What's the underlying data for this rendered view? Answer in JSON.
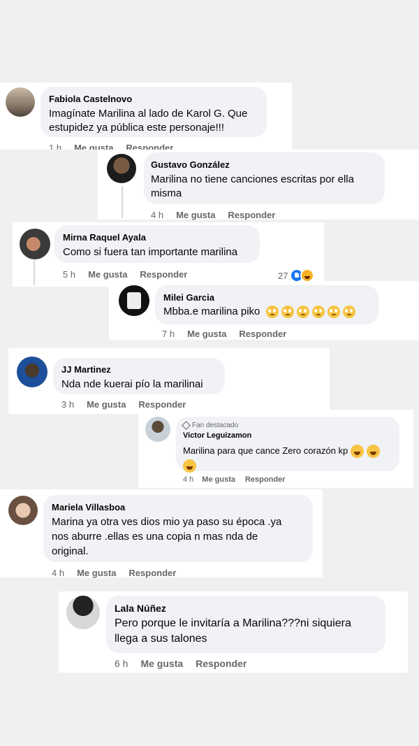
{
  "comments": [
    {
      "name": "Fabiola Castelnovo",
      "lines": [
        "Imagínate Marilina al lado de Karol G. Que",
        "estupidez ya pública este personaje!!!"
      ],
      "time": "1 h",
      "like": "Me gusta",
      "reply": "Responder"
    },
    {
      "name": "Gustavo González",
      "lines": [
        "Marilina no tiene canciones escritas por ella",
        "misma"
      ],
      "time": "4 h",
      "like": "Me gusta",
      "reply": "Responder"
    },
    {
      "name": "Mirna Raquel Ayala",
      "lines": [
        "Como si fuera tan importante marilina"
      ],
      "time": "5 h",
      "like": "Me gusta",
      "reply": "Responder",
      "reaction_count": "27"
    },
    {
      "name": "Milei Garcia",
      "lines": [
        "Mbba.e marilina piko"
      ],
      "time": "7 h",
      "like": "Me gusta",
      "reply": "Responder",
      "emoji_count": 6
    },
    {
      "name": "JJ Martinez",
      "lines": [
        "Nda nde kuerai pío la marilinai"
      ],
      "time": "3 h",
      "like": "Me gusta",
      "reply": "Responder"
    },
    {
      "name": "Victor Leguizamon",
      "badge": "Fan destacado",
      "lines": [
        "Marilina para que cance Zero corazón kp"
      ],
      "time": "4 h",
      "like": "Me gusta",
      "reply": "Responder"
    },
    {
      "name": "Mariela Villasboa",
      "lines": [
        "Marina ya otra ves dios mio ya paso su época .ya",
        "nos aburre .ellas es una copia n mas nda de",
        "original."
      ],
      "time": "4 h",
      "like": "Me gusta",
      "reply": "Responder"
    },
    {
      "name": "Lala Núñez",
      "lines": [
        "Pero porque le invitaría a Marilina???ni siquiera",
        "llega a sus talones"
      ],
      "time": "6 h",
      "like": "Me gusta",
      "reply": "Responder"
    }
  ],
  "icons": {
    "like_reaction": "thumbs-up-icon",
    "haha_reaction": "haha-icon",
    "emoji": "rolling-eyes-emoji",
    "laugh": "laughing-emoji",
    "badge": "diamond-icon"
  }
}
